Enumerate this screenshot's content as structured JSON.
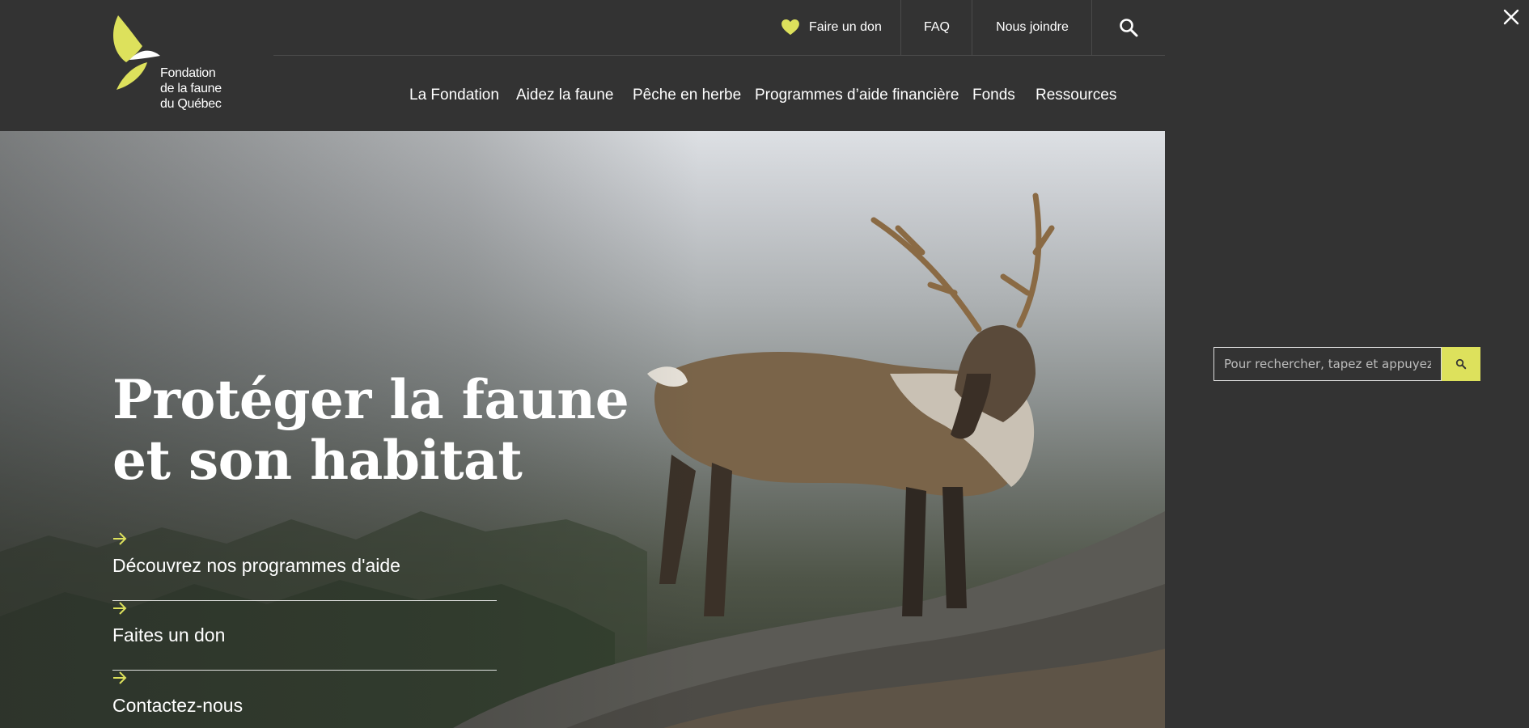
{
  "site": {
    "logo_lines": [
      "Fondation",
      "de la faune",
      "du Québec"
    ]
  },
  "utility_nav": {
    "donate_label": "Faire un don",
    "faq_label": "FAQ",
    "contact_label": "Nous joindre"
  },
  "main_nav": {
    "items": [
      {
        "label": "La Fondation"
      },
      {
        "label": "Aidez la faune"
      },
      {
        "label": "Pêche en herbe"
      },
      {
        "label": "Programmes d’aide financière"
      },
      {
        "label": "Fonds"
      },
      {
        "label": "Ressources"
      }
    ]
  },
  "hero": {
    "title_line1": "Protéger la faune",
    "title_line2": "et son habitat",
    "ctas": [
      {
        "label": "Découvrez nos programmes d'aide"
      },
      {
        "label": "Faites un don"
      },
      {
        "label": "Contactez-nous"
      }
    ]
  },
  "search": {
    "placeholder": "Pour rechercher, tapez et appuyez sur"
  },
  "colors": {
    "accent": "#dde15c",
    "background": "#333333"
  }
}
